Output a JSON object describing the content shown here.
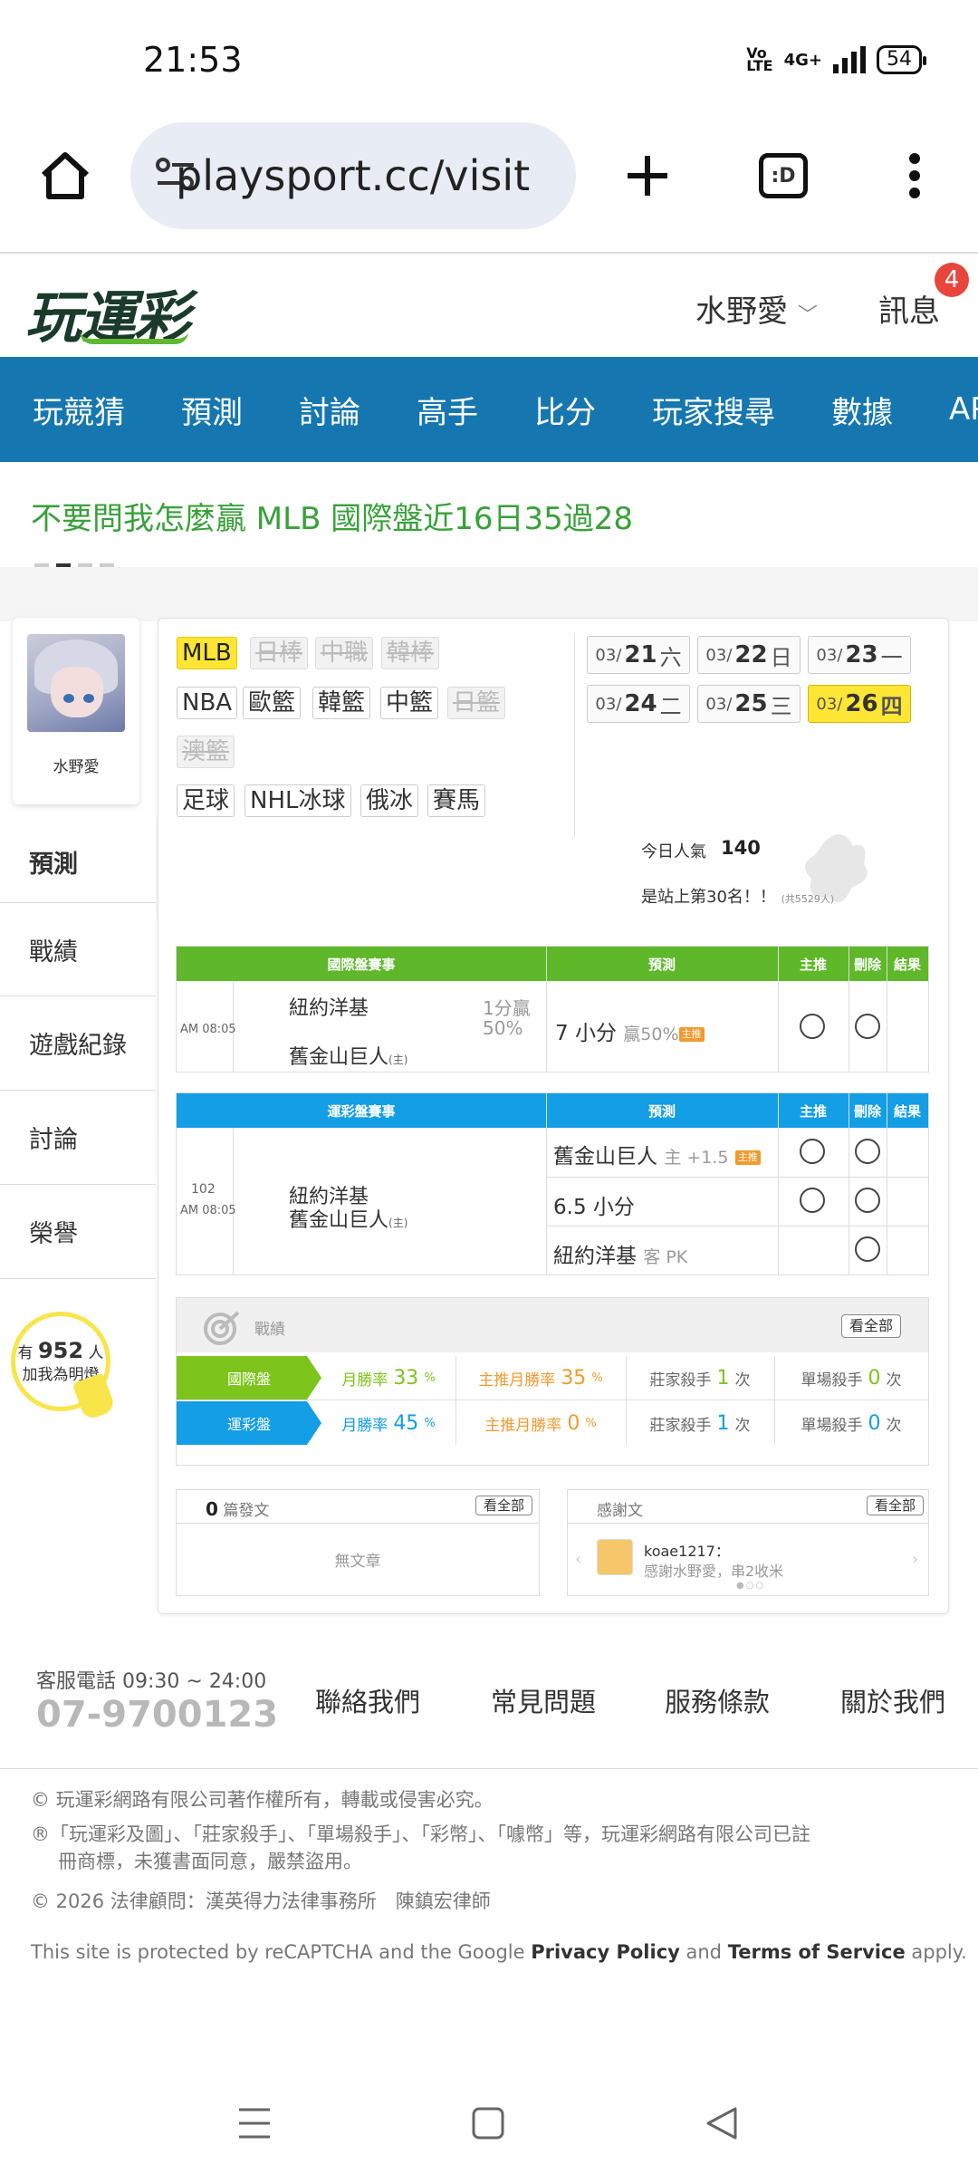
{
  "status_bar": {
    "time": "21:53",
    "network": "4G+",
    "battery": "54"
  },
  "browser": {
    "url": "playsport.cc/visit"
  },
  "site": {
    "logo": "玩運彩",
    "user_name": "水野愛",
    "messages_label": "訊息",
    "messages_count": "4"
  },
  "nav": {
    "items": [
      "玩競猜",
      "預測",
      "討論",
      "高手",
      "比分",
      "玩家搜尋",
      "數據",
      "APP"
    ]
  },
  "marquee": "不要問我怎麼贏 MLB 國際盤近16日35過28",
  "profile": {
    "name": "水野愛"
  },
  "sidebar": {
    "items": [
      "預測",
      "戰績",
      "遊戲紀錄",
      "討論",
      "榮譽"
    ]
  },
  "fans": {
    "prefix": "有",
    "count": "952",
    "suffix": "人",
    "line2": "加我為明燈"
  },
  "leagues": {
    "row1": [
      "MLB",
      "日棒",
      "中職",
      "韓棒"
    ],
    "row2": [
      "NBA",
      "歐籃",
      "韓籃",
      "中籃",
      "日籃"
    ],
    "row3": [
      "澳籃"
    ],
    "row4": [
      "足球",
      "NHL冰球",
      "俄冰",
      "賽馬"
    ]
  },
  "dates": [
    {
      "m": "03/",
      "d": "21",
      "w": "六"
    },
    {
      "m": "03/",
      "d": "22",
      "w": "日"
    },
    {
      "m": "03/",
      "d": "23",
      "w": "一"
    },
    {
      "m": "03/",
      "d": "24",
      "w": "二"
    },
    {
      "m": "03/",
      "d": "25",
      "w": "三"
    },
    {
      "m": "03/",
      "d": "26",
      "w": "四"
    }
  ],
  "popularity": {
    "label": "今日人氣",
    "value": "140",
    "rank": "是站上第30名！！",
    "rank_note": "(共5529人)"
  },
  "intl_table": {
    "headers": [
      "國際盤賽事",
      "預測",
      "主推",
      "刪除",
      "結果"
    ],
    "time": "AM 08:05",
    "away": "紐約洋基",
    "home": "舊金山巨人",
    "home_mark": "(主)",
    "line1": "1分贏",
    "line2": "50%",
    "pick": "7 小分",
    "pick_note": "贏50%",
    "tag": "主推"
  },
  "sport_table": {
    "headers": [
      "運彩盤賽事",
      "預測",
      "主推",
      "刪除",
      "結果"
    ],
    "game_no": "102",
    "time": "AM 08:05",
    "away": "紐約洋基",
    "home": "舊金山巨人",
    "home_mark": "(主)",
    "picks": [
      {
        "team": "舊金山巨人",
        "note": "主 +1.5",
        "tag": "主推"
      },
      {
        "team": "6.5 小分",
        "note": ""
      },
      {
        "team": "紐約洋基",
        "note": "客 PK"
      }
    ]
  },
  "stats": {
    "title": "戰績",
    "view_all": "看全部",
    "rows": [
      {
        "label": "國際盤",
        "color": "#7dc51c",
        "month_rate_label": "月勝率",
        "month_rate": "33",
        "main_rate_label": "主推月勝率",
        "main_rate": "35",
        "killer_label": "莊家殺手",
        "killer": "1",
        "single_label": "單場殺手",
        "single": "0",
        "unit_pct": "%",
        "unit_times": "次"
      },
      {
        "label": "運彩盤",
        "color": "#139ee6",
        "month_rate_label": "月勝率",
        "month_rate": "45",
        "main_rate_label": "主推月勝率",
        "main_rate": "0",
        "killer_label": "莊家殺手",
        "killer": "1",
        "single_label": "單場殺手",
        "single": "0",
        "unit_pct": "%",
        "unit_times": "次"
      }
    ]
  },
  "posts": {
    "count": "0",
    "label": "篇發文",
    "view_all": "看全部",
    "empty": "無文章"
  },
  "thanks": {
    "title": "感謝文",
    "view_all": "看全部",
    "user": "koae1217：",
    "text": "感謝水野愛，串2收米"
  },
  "footer": {
    "hotline_label": "客服電話 09:30 ~ 24:00",
    "hotline": "07-9700123",
    "links": [
      "聯絡我們",
      "常見問題",
      "服務條款",
      "關於我們"
    ],
    "legal1": "© 玩運彩網路有限公司著作權所有，轉載或侵害必究。",
    "legal2a": "®「玩運彩及圖」、「莊家殺手」、「單場殺手」、「彩幣」、「噱幣」等，玩運彩網路有限公司已註",
    "legal2b": "冊商標，未獲書面同意，嚴禁盜用。",
    "legal3": "© 2026 法律顧問：漢英得力法律事務所　陳鎮宏律師",
    "recaptcha_a": "This site is protected by reCAPTCHA and the Google ",
    "privacy": "Privacy Policy",
    "and": " and ",
    "terms": "Terms of Service",
    "apply": " apply."
  }
}
